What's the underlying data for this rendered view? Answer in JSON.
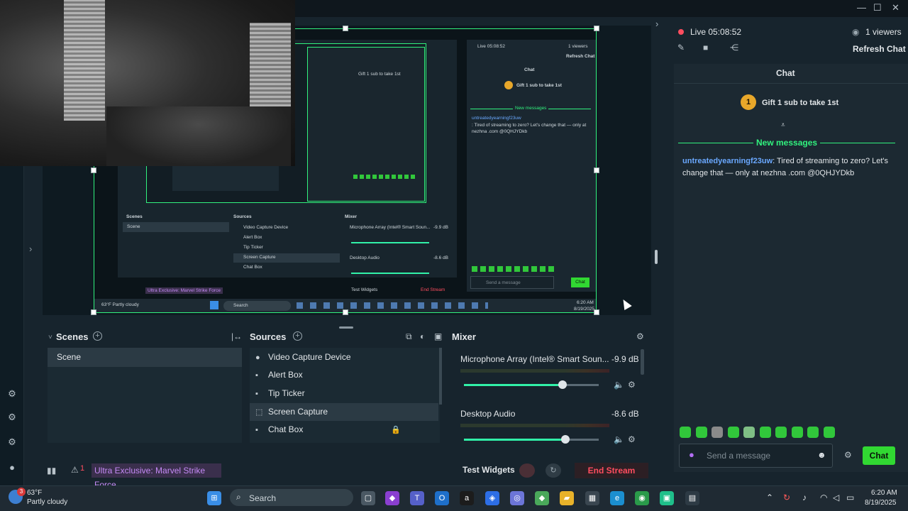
{
  "window": {
    "minimize": "—",
    "maximize": "☐",
    "close": "✕"
  },
  "preview": {
    "nested_chat_live": "Live 05:08:52",
    "nested_viewers": "1 viewers",
    "nested_refresh": "Refresh Chat",
    "nested_chat_title": "Chat",
    "nested_gift": "Gift 1 sub to take 1st",
    "nested_new_messages": "New messages",
    "nested_message_user": "untreatedyearningf23uw",
    "nested_message_text": ": Tired of streaming to zero? Let's change that — only at nezhna .com @0QHJYDkb",
    "nested_send_placeholder": "Send a message",
    "nested_chat_btn": "Chat",
    "nested_scenes": "Scenes",
    "nested_scene": "Scene",
    "nested_sources": "Sources",
    "nested_mixer": "Mixer",
    "nested_src1": "Video Capture Device",
    "nested_src2": "Alert Box",
    "nested_src3": "Tip Ticker",
    "nested_src4": "Screen Capture",
    "nested_src5": "Chat Box",
    "nested_mic": "Microphone Array (Intel® Smart Soun...",
    "nested_mic_db": "-9.9 dB",
    "nested_desktop": "Desktop Audio",
    "nested_desktop_db": "-8.6 dB",
    "nested_promo": "Ultra Exclusive: Marvel Strike Force",
    "nested_test": "Test Widgets",
    "nested_end": "End Stream",
    "nested_weather": "63°F Partly cloudy",
    "nested_search": "Search",
    "nested_time": "6:20 AM",
    "nested_date": "8/19/2025"
  },
  "scenes": {
    "title": "Scenes",
    "items": [
      "Scene"
    ]
  },
  "sources": {
    "title": "Sources",
    "items": [
      "Video Capture Device",
      "Alert Box",
      "Tip Ticker",
      "Screen Capture",
      "Chat Box"
    ]
  },
  "mixer": {
    "title": "Mixer",
    "channels": [
      {
        "name": "Microphone Array (Intel® Smart Soun...",
        "db": "-9.9 dB",
        "level": 0.73
      },
      {
        "name": "Desktop Audio",
        "db": "-8.6 dB",
        "level": 0.75
      }
    ]
  },
  "statusbar": {
    "alerts_count": "1",
    "promo": "Ultra Exclusive: Marvel Strike Force",
    "test_widgets": "Test Widgets",
    "end_stream": "End Stream"
  },
  "chat": {
    "live": "Live 05:08:52",
    "viewers": "1 viewers",
    "refresh": "Refresh Chat",
    "title": "Chat",
    "gift_badge": "1",
    "gift": "Gift 1 sub to take 1st",
    "new_messages": "New messages",
    "message_user": "untreatedyearningf23uw",
    "message_text": ": Tired of streaming to zero? Let's change that — only at nezhna .com @0QHJYDkb",
    "placeholder": "Send a message",
    "send_button": "Chat"
  },
  "taskbar": {
    "weather_badge": "3",
    "temp": "63°F",
    "condition": "Partly cloudy",
    "search": "Search",
    "time": "6:20 AM",
    "date": "8/19/2025"
  },
  "colors": {
    "accent": "#31f27e",
    "chat_green": "#31d832",
    "end_red": "#ff4d5f",
    "promo_purple": "#c58af6",
    "username_blue": "#6aa8ff"
  }
}
